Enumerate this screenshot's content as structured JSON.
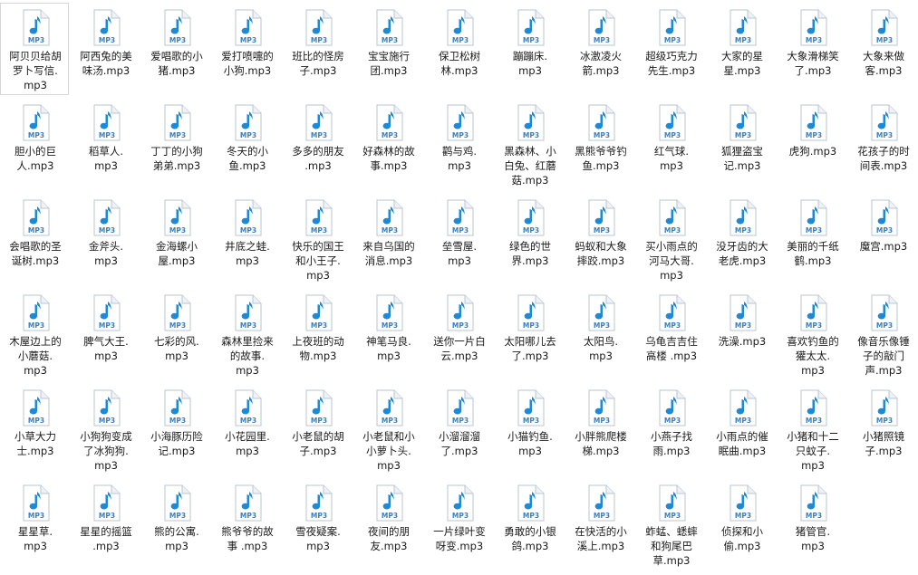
{
  "icon": {
    "name": "mp3-file-icon",
    "badge_text": "MP3",
    "note_color": "#1e8ad6",
    "badge_color": "#3a7fc4",
    "page_color": "#ffffff",
    "border_color": "#b9c4cf"
  },
  "selected_index": 0,
  "files": [
    {
      "lines": [
        "阿贝贝给胡",
        "罗卜写信.",
        "mp3"
      ]
    },
    {
      "lines": [
        "阿西兔的美",
        "味汤.mp3"
      ]
    },
    {
      "lines": [
        "爱唱歌的小",
        "猪.mp3"
      ]
    },
    {
      "lines": [
        "爱打喷嚏的",
        "小狗.mp3"
      ]
    },
    {
      "lines": [
        "班比的怪房",
        "子.mp3"
      ]
    },
    {
      "lines": [
        "宝宝施行",
        "团.mp3"
      ]
    },
    {
      "lines": [
        "保卫松树",
        "林.mp3"
      ]
    },
    {
      "lines": [
        "蹦蹦床.",
        "mp3"
      ]
    },
    {
      "lines": [
        "冰激凌火",
        "箭.mp3"
      ]
    },
    {
      "lines": [
        "超级巧克力",
        "先生.mp3"
      ]
    },
    {
      "lines": [
        "大家的星",
        "星.mp3"
      ]
    },
    {
      "lines": [
        "大象滑梯笑",
        "了.mp3"
      ]
    },
    {
      "lines": [
        "大象来做",
        "客.mp3"
      ]
    },
    {
      "lines": [
        "胆小的巨",
        "人.mp3"
      ]
    },
    {
      "lines": [
        "稻草人.",
        "mp3"
      ]
    },
    {
      "lines": [
        "丁丁的小狗",
        "弟弟.mp3"
      ]
    },
    {
      "lines": [
        "冬天的小",
        "鱼.mp3"
      ]
    },
    {
      "lines": [
        "多多的朋友",
        ".mp3"
      ]
    },
    {
      "lines": [
        "好森林的故",
        "事.mp3"
      ]
    },
    {
      "lines": [
        "鹳与鸡.",
        "mp3"
      ]
    },
    {
      "lines": [
        "黑森林、小",
        "白兔、红蘑",
        "菇.mp3"
      ]
    },
    {
      "lines": [
        "黑熊爷爷钓",
        "鱼.mp3"
      ]
    },
    {
      "lines": [
        "红气球.",
        "mp3"
      ]
    },
    {
      "lines": [
        "狐狸盗宝",
        "记.mp3"
      ]
    },
    {
      "lines": [
        "虎狗.mp3"
      ]
    },
    {
      "lines": [
        "花孩子的时",
        "间表.mp3"
      ]
    },
    {
      "lines": [
        "会唱歌的圣",
        "诞树.mp3"
      ]
    },
    {
      "lines": [
        "金斧头.",
        "mp3"
      ]
    },
    {
      "lines": [
        "金海螺小",
        "屋.mp3"
      ]
    },
    {
      "lines": [
        "井底之蛙.",
        "mp3"
      ]
    },
    {
      "lines": [
        "快乐的国王",
        "和小王子.",
        "mp3"
      ]
    },
    {
      "lines": [
        "来自乌国的",
        "消息.mp3"
      ]
    },
    {
      "lines": [
        "垒雪屋.",
        "mp3"
      ]
    },
    {
      "lines": [
        "绿色的世",
        "界.mp3"
      ]
    },
    {
      "lines": [
        "蚂蚁和大象",
        "摔跤.mp3"
      ]
    },
    {
      "lines": [
        "买小雨点的",
        "河马大哥.",
        "mp3"
      ]
    },
    {
      "lines": [
        "没牙齿的大",
        "老虎.mp3"
      ]
    },
    {
      "lines": [
        "美丽的千纸",
        "鹤.mp3"
      ]
    },
    {
      "lines": [
        "魔宫.mp3"
      ]
    },
    {
      "lines": [
        "木屋边上的",
        "小蘑菇.",
        "mp3"
      ]
    },
    {
      "lines": [
        "脾气大王.",
        "mp3"
      ]
    },
    {
      "lines": [
        "七彩的风.",
        "mp3"
      ]
    },
    {
      "lines": [
        "森林里捡来",
        "的故事.",
        "mp3"
      ]
    },
    {
      "lines": [
        "上夜班的动",
        "物.mp3"
      ]
    },
    {
      "lines": [
        "神笔马良.",
        "mp3"
      ]
    },
    {
      "lines": [
        "送你一片白",
        "云.mp3"
      ]
    },
    {
      "lines": [
        "太阳哪儿去",
        "了.mp3"
      ]
    },
    {
      "lines": [
        "太阳鸟.",
        "mp3"
      ]
    },
    {
      "lines": [
        "乌龟吉吉住",
        "高楼 .mp3"
      ]
    },
    {
      "lines": [
        "洗澡.mp3"
      ]
    },
    {
      "lines": [
        "喜欢钓鱼的",
        "獾太太.",
        "mp3"
      ]
    },
    {
      "lines": [
        "像音乐像锤",
        "子的敲门",
        "声.mp3"
      ]
    },
    {
      "lines": [
        "小草大力",
        "士.mp3"
      ]
    },
    {
      "lines": [
        "小狗狗变成",
        "了冰狗狗.",
        "mp3"
      ]
    },
    {
      "lines": [
        "小海豚历险",
        "记.mp3"
      ]
    },
    {
      "lines": [
        "小花园里.",
        "mp3"
      ]
    },
    {
      "lines": [
        "小老鼠的胡",
        "子.mp3"
      ]
    },
    {
      "lines": [
        "小老鼠和小",
        "小萝卜头.",
        "mp3"
      ]
    },
    {
      "lines": [
        "小溜溜溜",
        "了.mp3"
      ]
    },
    {
      "lines": [
        "小猫钓鱼.",
        "mp3"
      ]
    },
    {
      "lines": [
        "小胖熊爬楼",
        "梯.mp3"
      ]
    },
    {
      "lines": [
        "小燕子找",
        "雨.mp3"
      ]
    },
    {
      "lines": [
        "小雨点的催",
        "眠曲.mp3"
      ]
    },
    {
      "lines": [
        "小猪和十二",
        "只蚊子.",
        "mp3"
      ]
    },
    {
      "lines": [
        "小猪照镜",
        "子.mp3"
      ]
    },
    {
      "lines": [
        "星星草.",
        "mp3"
      ]
    },
    {
      "lines": [
        "星星的摇篮",
        ".mp3"
      ]
    },
    {
      "lines": [
        "熊的公寓.",
        "mp3"
      ]
    },
    {
      "lines": [
        "熊爷爷的故",
        "事 .mp3"
      ]
    },
    {
      "lines": [
        "雪夜疑案.",
        "mp3"
      ]
    },
    {
      "lines": [
        "夜间的朋",
        "友.mp3"
      ]
    },
    {
      "lines": [
        "一片绿叶变",
        "呀变.mp3"
      ]
    },
    {
      "lines": [
        "勇敢的小银",
        "鸽.mp3"
      ]
    },
    {
      "lines": [
        "在快活的小",
        "溪上.mp3"
      ]
    },
    {
      "lines": [
        "蚱蜢、蟋蟀",
        "和狗尾巴",
        "草.mp3"
      ]
    },
    {
      "lines": [
        "侦探和小",
        "偷.mp3"
      ]
    },
    {
      "lines": [
        "猪管官.",
        "mp3"
      ]
    }
  ]
}
